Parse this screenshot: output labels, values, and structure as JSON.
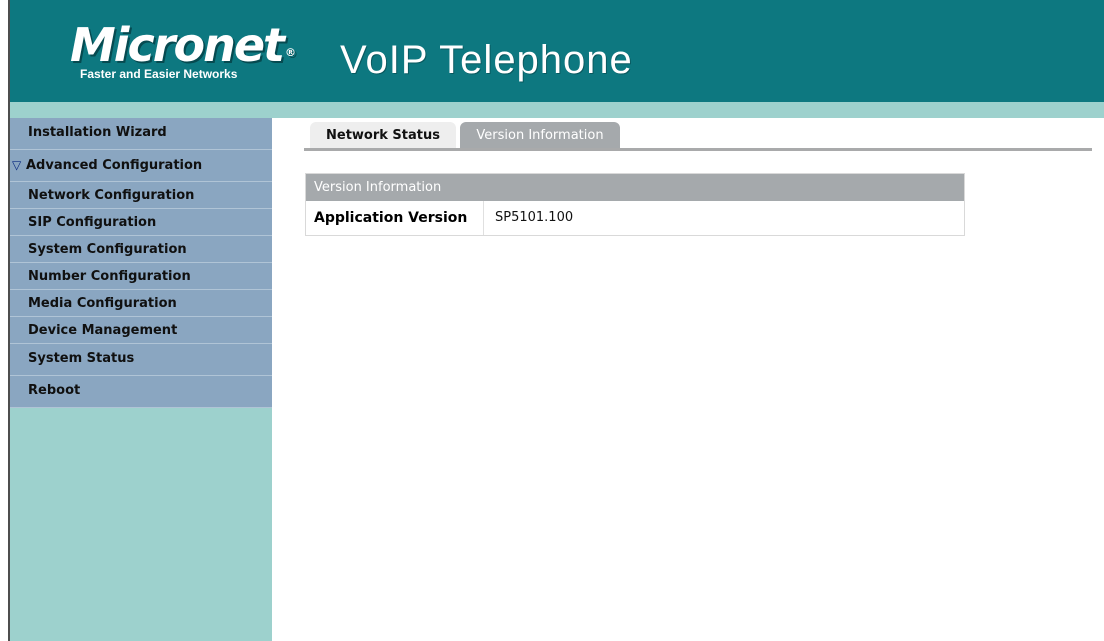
{
  "header": {
    "logo_text": "Micronet",
    "logo_reg": "®",
    "logo_tagline": "Faster and Easier Networks",
    "title": "VoIP Telephone"
  },
  "sidebar": {
    "items": [
      {
        "label": "Installation Wizard"
      },
      {
        "label": "Advanced Configuration",
        "icon": "triangle-down-icon",
        "glyph": "▽"
      },
      {
        "label": "Network Configuration"
      },
      {
        "label": "SIP Configuration"
      },
      {
        "label": "System Configuration"
      },
      {
        "label": "Number Configuration"
      },
      {
        "label": "Media Configuration"
      },
      {
        "label": "Device Management"
      },
      {
        "label": "System Status"
      },
      {
        "label": "Reboot"
      }
    ]
  },
  "tabs": [
    {
      "label": "Network Status"
    },
    {
      "label": "Version Information",
      "active": true
    }
  ],
  "panel": {
    "title": "Version Information",
    "rows": [
      {
        "label": "Application Version",
        "value": "SP5101.100"
      }
    ]
  },
  "colors": {
    "header": "#0d7880",
    "strip": "#9dd1cd",
    "menu": "#8aa6c1",
    "tab_active": "#a5a9ac",
    "panel_head": "#a5a9ac"
  }
}
